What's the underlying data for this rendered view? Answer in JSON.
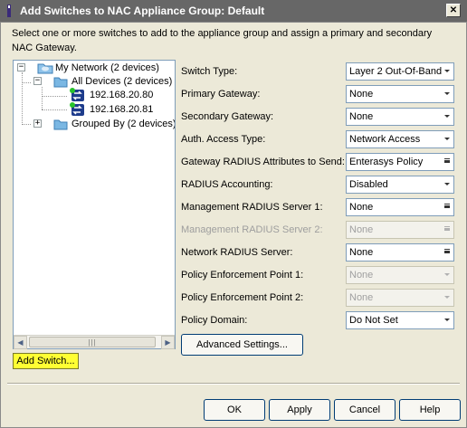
{
  "window": {
    "title": "Add Switches to NAC Appliance Group: Default",
    "close_label": "✕"
  },
  "instructions": "Select one or more switches to add to the appliance group and assign a primary and secondary NAC Gateway.",
  "tree": {
    "root": "My Network (2 devices)",
    "all_devices": "All Devices (2 devices)",
    "devices": [
      "192.168.20.80",
      "192.168.20.81"
    ],
    "grouped_by": "Grouped By (2 devices)",
    "expander_expanded": "−",
    "expander_collapsed": "+"
  },
  "scrollbar": {
    "left_arrow": "◀",
    "right_arrow": "▶",
    "grip": "|||"
  },
  "add_switch_label": "Add Switch...",
  "fields": [
    {
      "label": "Switch Type:",
      "value": "Layer 2 Out-Of-Band",
      "enabled": true
    },
    {
      "label": "Primary Gateway:",
      "value": "None",
      "enabled": true
    },
    {
      "label": "Secondary Gateway:",
      "value": "None",
      "enabled": true
    },
    {
      "label": "Auth. Access Type:",
      "value": "Network Access",
      "enabled": true
    },
    {
      "label": "Gateway RADIUS Attributes to Send:",
      "value": "Enterasys Policy",
      "enabled": true
    },
    {
      "label": "RADIUS Accounting:",
      "value": "Disabled",
      "enabled": true
    },
    {
      "label": "Management RADIUS Server 1:",
      "value": "None",
      "enabled": true
    },
    {
      "label": "Management RADIUS Server 2:",
      "value": "None",
      "enabled": false
    },
    {
      "label": "Network RADIUS Server:",
      "value": "None",
      "enabled": true
    },
    {
      "label": "Policy Enforcement Point 1:",
      "value": "None",
      "enabled": false
    },
    {
      "label": "Policy Enforcement Point 2:",
      "value": "None",
      "enabled": false
    },
    {
      "label": "Policy Domain:",
      "value": "Do Not Set",
      "enabled": true
    }
  ],
  "advanced_settings_label": "Advanced Settings...",
  "buttons": {
    "ok": "OK",
    "apply": "Apply",
    "cancel": "Cancel",
    "help": "Help"
  }
}
